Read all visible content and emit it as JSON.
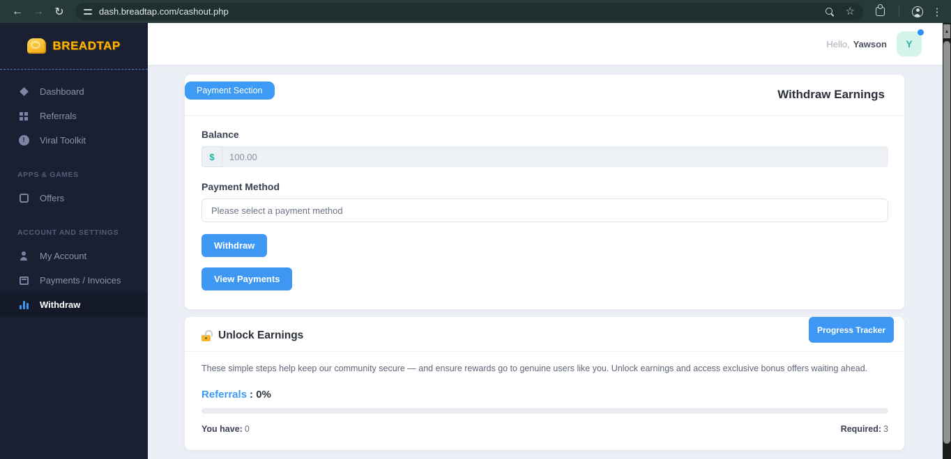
{
  "browser": {
    "url": "dash.breadtap.com/cashout.php"
  },
  "icons": {
    "back": "←",
    "forward": "→",
    "reload": "↻",
    "star": "☆",
    "menu": "⋮",
    "alert": "!",
    "scroll_up": "▲"
  },
  "sidebar": {
    "brand": "BreadTap",
    "groups": [
      {
        "items": [
          "Dashboard",
          "Referrals",
          "Viral Toolkit"
        ]
      },
      {
        "header": "APPS & GAMES",
        "items": [
          "Offers"
        ]
      },
      {
        "header": "ACCOUNT AND SETTINGS",
        "items": [
          "My Account",
          "Payments / Invoices",
          "Withdraw"
        ]
      }
    ],
    "active_item": "Withdraw"
  },
  "header": {
    "greeting": "Hello,",
    "username": "Yawson",
    "avatar_initial": "Y"
  },
  "payment_card": {
    "badge": "Payment Section",
    "title": "Withdraw Earnings",
    "balance_label": "Balance",
    "currency_symbol": "$",
    "balance_value": "100.00",
    "method_label": "Payment Method",
    "method_placeholder": "Please select a payment method",
    "withdraw_button": "Withdraw",
    "view_payments_button": "View Payments"
  },
  "unlock_card": {
    "title": "Unlock Earnings",
    "tracker_button": "Progress Tracker",
    "description": "These simple steps help keep our community secure — and ensure rewards go to genuine users like you. Unlock earnings and access exclusive bonus offers waiting ahead.",
    "referrals_label": "Referrals",
    "referrals_value": ": 0%",
    "progress_percent": 0,
    "you_have_label": "You have:",
    "you_have_value": "0",
    "required_label": "Required:",
    "required_value": "3"
  },
  "colors": {
    "accent_blue": "#3e97f2",
    "brand_gold": "#ffb408",
    "teal": "#19b8a2",
    "sidebar_bg": "#1a2032",
    "toolbar_bg": "#263a39"
  }
}
